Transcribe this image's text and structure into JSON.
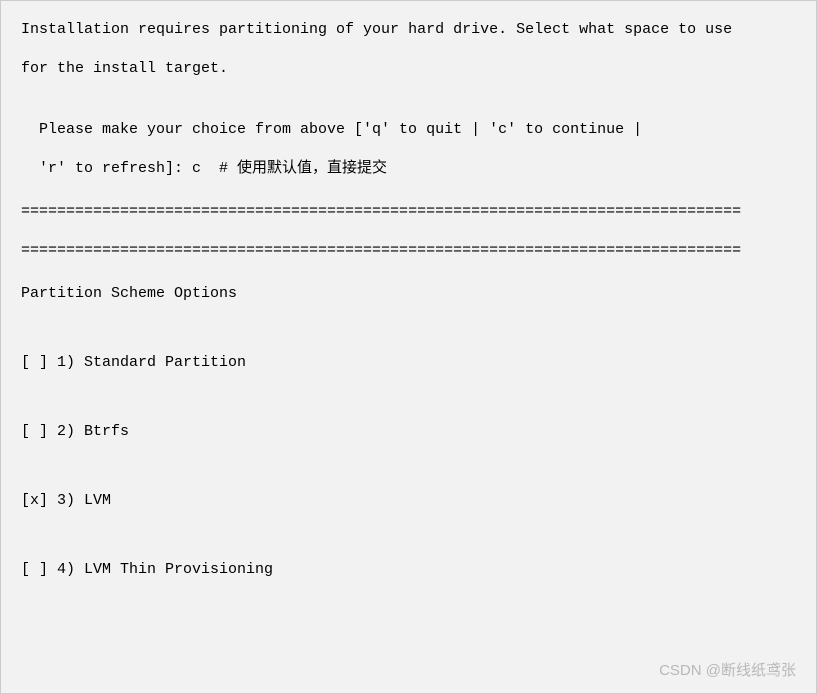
{
  "intro": {
    "line1": "Installation requires partitioning of your hard drive. Select what space to use",
    "line2": "for the install target."
  },
  "prompt": {
    "line1": "Please make your choice from above ['q' to quit | 'c' to continue |",
    "line2_prefix": "'r' to refresh]: ",
    "input_value": "c",
    "comment": "  # 使用默认值，直接提交"
  },
  "divider": "================================================================================",
  "section_title": "Partition Scheme Options",
  "options": [
    {
      "checked": false,
      "num": "1",
      "label": "Standard Partition"
    },
    {
      "checked": false,
      "num": "2",
      "label": "Btrfs"
    },
    {
      "checked": true,
      "num": "3",
      "label": "LVM"
    },
    {
      "checked": false,
      "num": "4",
      "label": "LVM Thin Provisioning"
    }
  ],
  "watermark": "CSDN @断线纸鸢张"
}
